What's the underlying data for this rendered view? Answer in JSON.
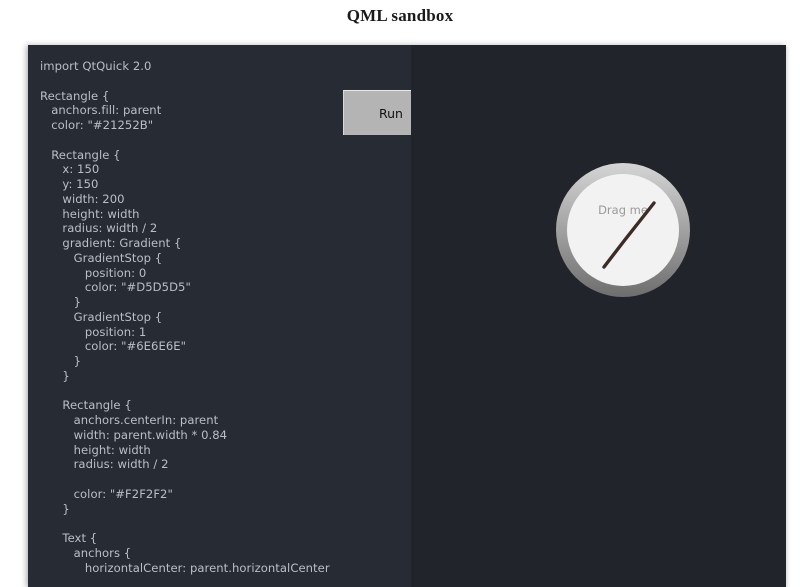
{
  "page": {
    "title": "QML sandbox",
    "background_color": "#ffffff",
    "title_color": "#1a1a1a"
  },
  "editor": {
    "background_color": "#272b33",
    "text_color": "#b9bfc9",
    "code": "import QtQuick 2.0\n\nRectangle {\n   anchors.fill: parent\n   color: \"#21252B\"\n\n   Rectangle {\n      x: 150\n      y: 150\n      width: 200\n      height: width\n      radius: width / 2\n      gradient: Gradient {\n         GradientStop {\n            position: 0\n            color: \"#D5D5D5\"\n         }\n         GradientStop {\n            position: 1\n            color: \"#6E6E6E\"\n         }\n      }\n\n      Rectangle {\n         anchors.centerIn: parent\n         width: parent.width * 0.84\n         height: width\n         radius: width / 2\n\n         color: \"#F2F2F2\"\n      }\n\n      Text {\n         anchors {\n            horizontalCenter: parent.horizontalCenter"
  },
  "toolbar": {
    "run_label": "Run",
    "run_background": "#b4b4b4"
  },
  "preview": {
    "background_color": "#21252b",
    "gauge": {
      "label": "Drag me",
      "label_color": "#9a9a9a",
      "ring_gradient_start": "#D5D5D5",
      "ring_gradient_end": "#6E6E6E",
      "face_color": "#F2F2F2",
      "needle_color": "#3d2b25",
      "needle_angle_degrees": 47
    }
  }
}
